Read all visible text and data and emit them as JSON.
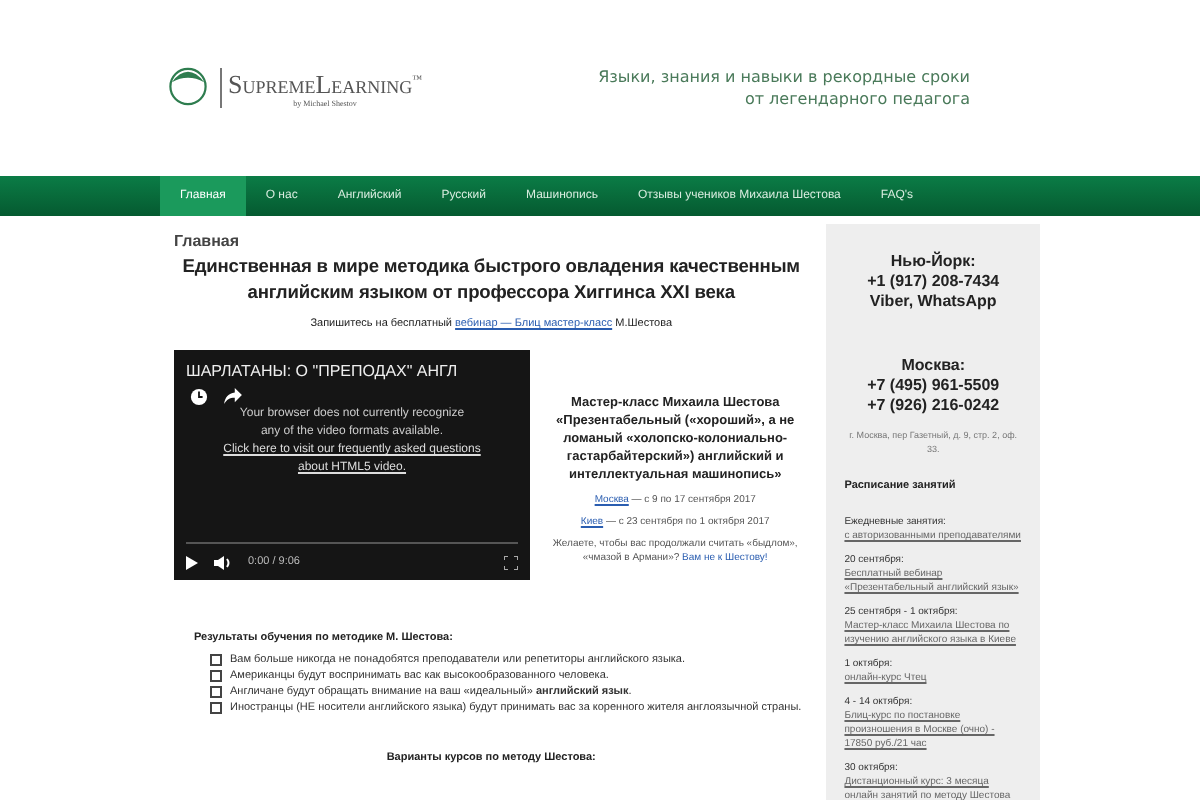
{
  "header": {
    "logo_title": "SupremeLearning",
    "logo_mark": "™",
    "logo_byline": "by Michael Shestov",
    "tagline": [
      "Языки, знания и навыки в рекордные сроки",
      "от легендарного педагога"
    ]
  },
  "nav": [
    {
      "label": "Главная",
      "selected": true
    },
    {
      "label": "О нас",
      "selected": false
    },
    {
      "label": "Английский",
      "selected": false
    },
    {
      "label": "Русский",
      "selected": false
    },
    {
      "label": "Машинопись",
      "selected": false
    },
    {
      "label": "Отзывы учеников Михаила Шестова",
      "selected": false
    },
    {
      "label": "FAQ's",
      "selected": false
    }
  ],
  "main": {
    "page_title": "Главная",
    "headline": "Единственная в мире методика быстрого овладения качественным английским языком от профессора Хиггинса XXI века",
    "signup": {
      "before": "Запишитесь на бесплатный",
      "link": "вебинар — Блиц мастер-класс",
      "after": "М.Шестова"
    },
    "video": {
      "title": "ШАРЛАТАНЫ: О \"ПРЕПОДАХ\" АНГЛ",
      "message": "Your browser does not currently recognize any of the video formats available.",
      "link": "Click here to visit our frequently asked questions about HTML5 video.",
      "time": "0:00 / 9:06"
    },
    "masterclass": {
      "title": "Мастер-класс Михаила Шестова «Презентабельный («хороший», а не ломаный «холопско-колониально-гастарбайтерский») английский и интеллектуальная машинопись»",
      "cities": [
        {
          "city": "Москва",
          "dates": "— с 9 по 17 сентября 2017"
        },
        {
          "city": "Киев",
          "dates": "— с 23 сентября по 1 октября 2017"
        }
      ],
      "note": "Желаете, чтобы вас продолжали считать «быдлом», «чмазой в Армани»?",
      "note_link": "Вам не к Шестову!"
    },
    "results": {
      "title": "Результаты обучения по методике М. Шестова:",
      "items": [
        {
          "text": "Вам больше никогда не понадобятся преподаватели или репетиторы английского языка."
        },
        {
          "text": "Американцы будут воспринимать вас как высокообразованного человека."
        },
        {
          "text": "Англичане будут обращать внимание на ваш «идеальный» **английский язык**."
        },
        {
          "text": "Иностранцы (НЕ носители английского языка) будут принимать вас за коренного жителя англоязычной страны."
        }
      ]
    },
    "courses_title": "Варианты курсов по методу Шестова:"
  },
  "sidebar": {
    "contacts": [
      {
        "city": "Нью-Йорк:",
        "lines": [
          "+1 (917) 208-7434",
          "Viber, WhatsApp"
        ]
      },
      {
        "city": "Москва:",
        "lines": [
          "+7 (495) 961-5509",
          "+7 (926) 216-0242"
        ]
      }
    ],
    "address": "г. Москва, пер Газетный, д. 9, стр. 2, оф. 33.",
    "schedule_title": "Расписание занятий",
    "schedule": [
      {
        "date": "Ежедневные занятия:",
        "link": "с авторизованными преподавателями"
      },
      {
        "date": "20 сентября:",
        "link": "Бесплатный вебинар «Презентабельный английский язык»"
      },
      {
        "date": "25 сентября - 1 октября:",
        "link": "Мастер-класс Михаила Шестова по изучению английского языка в Киеве"
      },
      {
        "date": "1 октября:",
        "link": "онлайн-курс Чтец"
      },
      {
        "date": "4 - 14 октября:",
        "link": "Блиц-курс по постановке произношения в Москве (очно) - 17850 руб./21 час"
      },
      {
        "date": "30 октября:",
        "link": "Дистанционный курс: 3 месяца онлайн занятий по методу Шестова"
      }
    ]
  }
}
